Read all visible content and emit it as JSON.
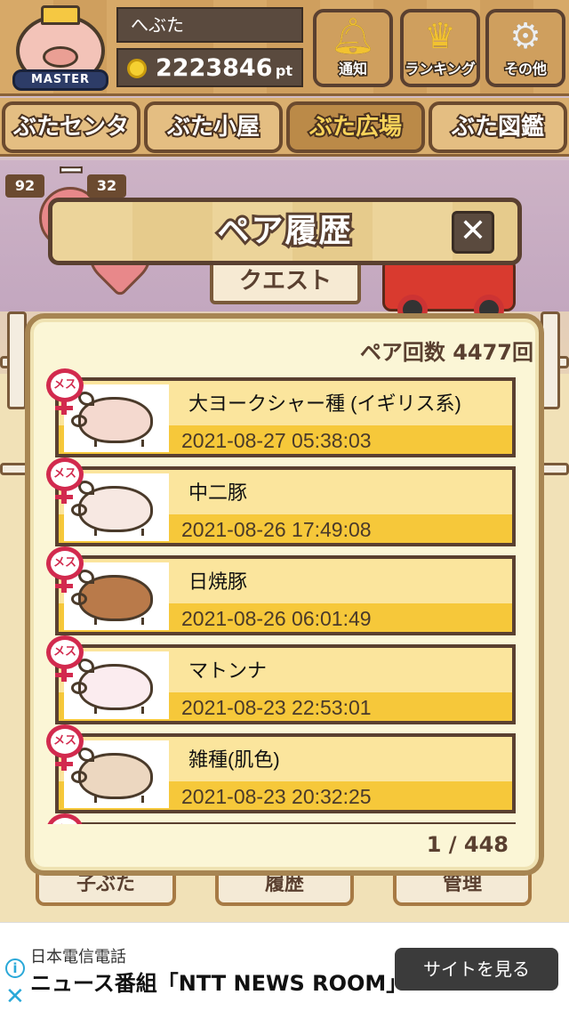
{
  "header": {
    "badge_text": "MASTER",
    "user_name": "へぶた",
    "points_value": "2223846",
    "points_unit": "pt",
    "buttons": [
      {
        "label": "通知",
        "icon": "bell-icon"
      },
      {
        "label": "ランキング",
        "icon": "crown-icon"
      },
      {
        "label": "その他",
        "icon": "gear-icon"
      }
    ]
  },
  "nav": {
    "tabs": [
      {
        "label": "ぶたセンター",
        "active": false
      },
      {
        "label": "ぶた小屋",
        "active": false
      },
      {
        "label": "ぶた広場",
        "active": true
      },
      {
        "label": "ぶた図鑑",
        "active": false
      }
    ]
  },
  "background": {
    "badge_left": "92",
    "badge_right": "32",
    "quest_sign": "クエスト",
    "bottom_buttons": [
      "子ぶた",
      "履歴",
      "管理"
    ]
  },
  "dialog": {
    "title": "ペア履歴",
    "close_label": "✕",
    "pair_count_label": "ペア回数 4477回",
    "entries": [
      {
        "badge": "メス",
        "name": "大ヨークシャー種 (イギリス系)",
        "date": "2021-08-27 05:38:03",
        "pig_color": "#f4d9cf"
      },
      {
        "badge": "メス",
        "name": "中二豚",
        "date": "2021-08-26 17:49:08",
        "pig_color": "#f7e8e2"
      },
      {
        "badge": "メス",
        "name": "日焼豚",
        "date": "2021-08-26 06:01:49",
        "pig_color": "#b97a4a"
      },
      {
        "badge": "メス",
        "name": "マトンナ",
        "date": "2021-08-23 22:53:01",
        "pig_color": "#fbecef"
      },
      {
        "badge": "メス",
        "name": "雑種(肌色)",
        "date": "2021-08-23 20:32:25",
        "pig_color": "#ecd7c0"
      },
      {
        "badge": "メス",
        "name": "",
        "date": "",
        "pig_color": "#f4d9cf"
      }
    ],
    "pager": "1 / 448"
  },
  "ad": {
    "company": "日本電信電話",
    "headline": "ニュース番組「NTT NEWS ROOM」",
    "cta": "サイトを見る",
    "info_icon": "i",
    "close_icon": "✕"
  }
}
